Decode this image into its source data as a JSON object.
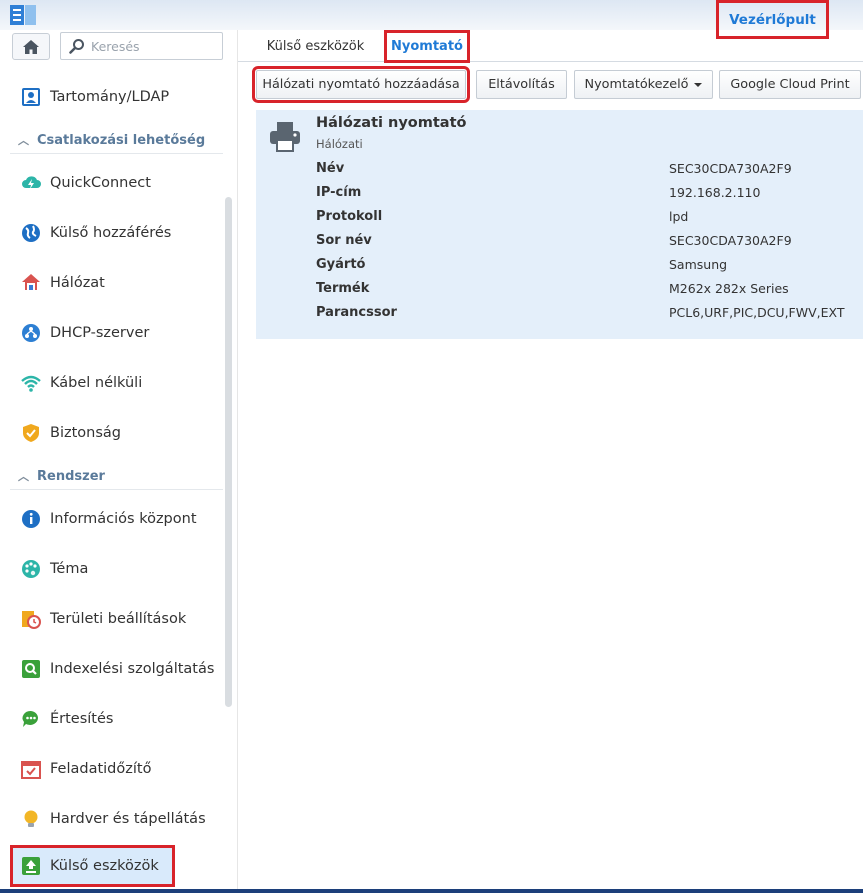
{
  "window": {
    "title": "Vezérlőpult"
  },
  "search": {
    "placeholder": "Keresés"
  },
  "sidebar": {
    "top_item": "Tartomány/LDAP",
    "section_connectivity": "Csatlakozási lehetőség",
    "connectivity_items": [
      "QuickConnect",
      "Külső hozzáférés",
      "Hálózat",
      "DHCP-szerver",
      "Kábel nélküli",
      "Biztonság"
    ],
    "section_system": "Rendszer",
    "system_items": [
      "Információs központ",
      "Téma",
      "Területi beállítások",
      "Indexelési szolgáltatás",
      "Értesítés",
      "Feladatidőzítő",
      "Hardver és tápellátás",
      "Külső eszközök"
    ]
  },
  "tabs": [
    "Külső eszközök",
    "Nyomtató"
  ],
  "toolbar": {
    "add_network_printer": "Hálózati nyomtató hozzáadása",
    "remove": "Eltávolítás",
    "printer_manager": "Nyomtatókezelő",
    "google_cloud_print": "Google Cloud Print"
  },
  "printer": {
    "name": "Hálózati nyomtató",
    "type": "Hálózati",
    "properties": [
      {
        "label": "Név",
        "value": "SEC30CDA730A2F9"
      },
      {
        "label": "IP-cím",
        "value": "192.168.2.110"
      },
      {
        "label": "Protokoll",
        "value": "lpd"
      },
      {
        "label": "Sor név",
        "value": "SEC30CDA730A2F9"
      },
      {
        "label": "Gyártó",
        "value": "Samsung"
      },
      {
        "label": "Termék",
        "value": "M262x 282x Series"
      },
      {
        "label": "Parancssor",
        "value": "PCL6,URF,PIC,DCU,FWV,EXT"
      }
    ]
  },
  "colors": {
    "accent": "#1f7ad6",
    "highlight_border": "#d8232a",
    "selected_bg": "#d9eafb",
    "card_bg": "#e4effa"
  }
}
